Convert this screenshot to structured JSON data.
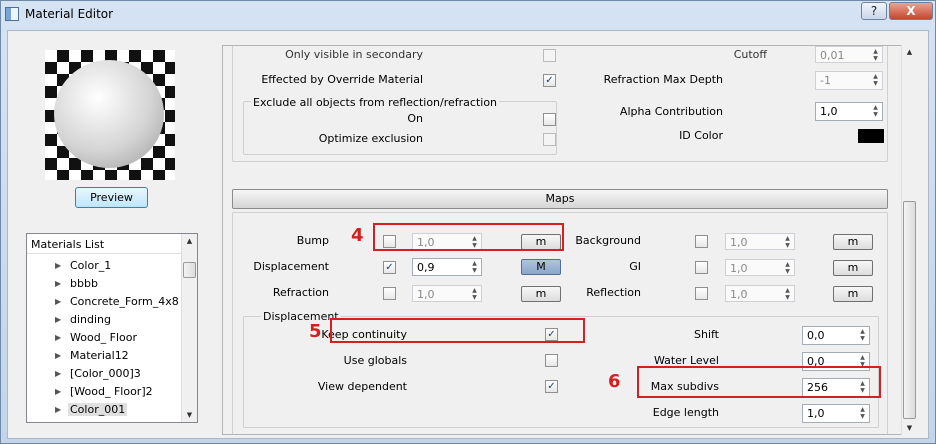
{
  "window": {
    "title": "Material Editor",
    "help_label": "?",
    "close_label": "X"
  },
  "left": {
    "preview_button": "Preview",
    "materials_list": {
      "header": "Materials List",
      "items": [
        "Color_1",
        "bbbb",
        "Concrete_Form_4x8",
        "dinding",
        "Wood_ Floor",
        "Material12",
        "[Color_000]3",
        "[Wood_ Floor]2",
        "Color_001"
      ],
      "selected": "Color_001"
    }
  },
  "top_section": {
    "only_visible_secondary": "Only visible in secondary",
    "effected_override": "Effected by Override Material",
    "exclude_group_title": "Exclude all objects from reflection/refraction",
    "on_label": "On",
    "optimize_exclusion": "Optimize exclusion",
    "cutoff_label": "Cutoff",
    "cutoff_value": "0,01",
    "refraction_max_depth_label": "Refraction Max Depth",
    "refraction_max_depth_value": "-1",
    "alpha_contribution_label": "Alpha Contribution",
    "alpha_contribution_value": "1,0",
    "id_color_label": "ID Color",
    "id_color_value": "#000000"
  },
  "maps": {
    "title": "Maps",
    "rows_left": [
      {
        "label": "Bump",
        "checked": false,
        "value": "1,0",
        "button": "m",
        "active": false
      },
      {
        "label": "Displacement",
        "checked": true,
        "value": "0,9",
        "button": "M",
        "active": true
      },
      {
        "label": "Refraction",
        "checked": false,
        "value": "1,0",
        "button": "m",
        "active": false
      }
    ],
    "rows_right": [
      {
        "label": "Background",
        "checked": false,
        "value": "1,0",
        "button": "m"
      },
      {
        "label": "GI",
        "checked": false,
        "value": "1,0",
        "button": "m"
      },
      {
        "label": "Reflection",
        "checked": false,
        "value": "1,0",
        "button": "m"
      }
    ]
  },
  "displacement": {
    "group_title": "Displacement",
    "keep_continuity": "Keep continuity",
    "keep_continuity_checked": true,
    "use_globals": "Use globals",
    "use_globals_checked": false,
    "view_dependent": "View dependent",
    "view_dependent_checked": true,
    "shift_label": "Shift",
    "shift_value": "0,0",
    "water_level_label": "Water Level",
    "water_level_value": "0,0",
    "max_subdivs_label": "Max subdivs",
    "max_subdivs_value": "256",
    "edge_length_label": "Edge length",
    "edge_length_value": "1,0"
  },
  "annotations": {
    "n4": "4",
    "n5": "5",
    "n6": "6",
    "highlight_color": "#d42020"
  }
}
